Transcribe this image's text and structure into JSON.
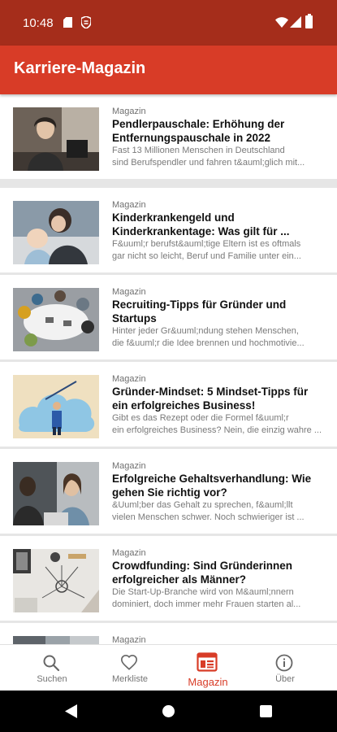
{
  "status_bar": {
    "time": "10:48"
  },
  "app_bar": {
    "title": "Karriere-Magazin"
  },
  "articles": [
    {
      "category": "Magazin",
      "headline": "Pendlerpauschale: Erhöhung der\nEntfernungspauschale in 2022",
      "summary": "Fast 13 Millionen Menschen in Deutschland\nsind Berufspendler und fahren t&auml;glich mit..."
    },
    {
      "category": "Magazin",
      "headline": "Kinderkrankengeld und\nKinderkrankentage: Was gilt für ...",
      "summary": "F&uuml;r berufst&auml;tige Eltern ist es oftmals\ngar nicht so leicht, Beruf und Familie unter ein..."
    },
    {
      "category": "Magazin",
      "headline": "Recruiting-Tipps für Gründer und\nStartups",
      "summary": "Hinter jeder Gr&uuml;ndung stehen Menschen,\ndie f&uuml;r die Idee brennen und hochmotivie..."
    },
    {
      "category": "Magazin",
      "headline": "Gründer-Mindset: 5 Mindset-Tipps für\nein erfolgreiches Business!",
      "summary": "Gibt es das Rezept oder die Formel f&uuml;r\nein erfolgreiches Business? Nein, die einzig wahre ..."
    },
    {
      "category": "Magazin",
      "headline": "Erfolgreiche Gehaltsverhandlung: Wie\ngehen Sie richtig vor?",
      "summary": "&Uuml;ber das Gehalt zu sprechen, f&auml;llt\nvielen Menschen schwer. Noch schwieriger ist ..."
    },
    {
      "category": "Magazin",
      "headline": "Crowdfunding: Sind Gründerinnen\nerfolgreicher als Männer?",
      "summary": "Die Start-Up-Branche wird von M&auml;nnern\ndominiert, doch immer mehr Frauen starten al..."
    },
    {
      "category": "Magazin",
      "headline": "",
      "summary": ""
    }
  ],
  "bottom_nav": {
    "items": [
      {
        "label": "Suchen",
        "icon": "search-icon"
      },
      {
        "label": "Merkliste",
        "icon": "heart-icon"
      },
      {
        "label": "Magazin",
        "icon": "newspaper-icon",
        "active": true
      },
      {
        "label": "Über",
        "icon": "info-icon"
      }
    ]
  },
  "colors": {
    "status_bar": "#a52d1b",
    "app_bar": "#d83c27",
    "accent": "#d83c27",
    "background": "#e6e6e6"
  }
}
